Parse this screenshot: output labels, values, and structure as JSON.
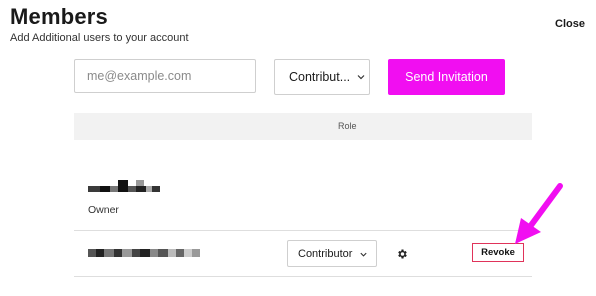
{
  "header": {
    "title": "Members",
    "subtitle": "Add Additional users to your account",
    "close_label": "Close"
  },
  "invite": {
    "email_placeholder": "me@example.com",
    "email_value": "",
    "role_selected": "Contribut...",
    "send_label": "Send Invitation"
  },
  "table": {
    "role_header": "Role",
    "rows": [
      {
        "name": "",
        "role_text": "Owner"
      },
      {
        "name": "",
        "role_selected": "Contributor",
        "revoke_label": "Revoke"
      }
    ]
  },
  "colors": {
    "accent": "#f10ef1",
    "revoke_border": "#e0335a",
    "header_bg": "#f2f2f2"
  },
  "icons": [
    "chevron-down-icon",
    "gear-icon",
    "arrow-pointer-icon"
  ]
}
